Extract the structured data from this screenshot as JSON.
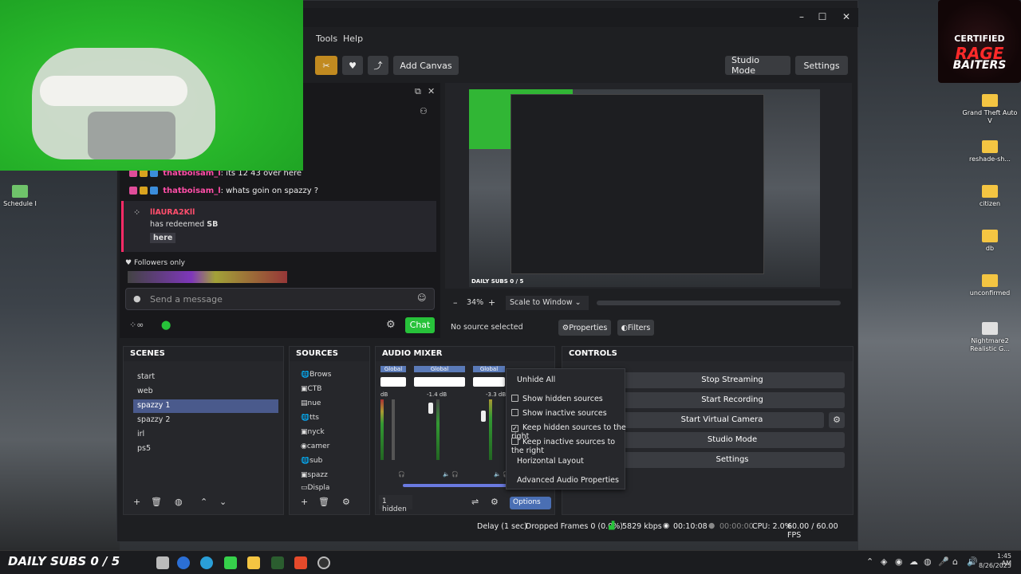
{
  "desktop": {
    "icons": [
      {
        "label": "Schedule I"
      },
      {
        "label": "Grand Theft Auto V"
      },
      {
        "label": "reshade-sh..."
      },
      {
        "label": "citizen"
      },
      {
        "label": "db"
      },
      {
        "label": "unconfirmed"
      },
      {
        "label": "Nightmare2 Realistic G..."
      }
    ]
  },
  "logo": {
    "line1": "CERTIFIED",
    "line2": "RAGE",
    "line3": "BAITERS"
  },
  "menu": {
    "tools": "Tools",
    "help": "Help"
  },
  "toolbar": {
    "add_canvas": "Add Canvas",
    "studio_mode": "Studio Mode",
    "settings": "Settings"
  },
  "chat": {
    "messages": [
      {
        "name": "thatboisam_l",
        "text": ": its 12 43 over here"
      },
      {
        "name": "thatboisam_l",
        "text": ": whats goin on spazzy ?"
      }
    ],
    "redeem": {
      "user": "llAURA2Kll",
      "text": "has redeemed",
      "reward": "SB",
      "message": "here"
    },
    "followers_only": "Followers only",
    "placeholder": "Send a message",
    "chat_button": "Chat"
  },
  "preview": {
    "zoom": "34%",
    "scale_mode": "Scale to Window",
    "no_source": "No source selected",
    "properties": "Properties",
    "filters": "Filters",
    "overlay_text": "DAILY SUBS 0 / 5"
  },
  "scenes": {
    "title": "SCENES",
    "items": [
      "start",
      "web",
      "spazzy 1",
      "spazzy 2",
      "irl",
      "ps5"
    ],
    "selected": "spazzy 1"
  },
  "sources": {
    "title": "SOURCES",
    "items": [
      "Brows",
      "CTB",
      "nue",
      "tts",
      "nyck",
      "camer",
      "sub",
      "spazz",
      "Displa"
    ]
  },
  "audio_mixer": {
    "title": "AUDIO MIXER",
    "channels": [
      {
        "label": "Global",
        "db": "dB"
      },
      {
        "label": "Global",
        "db": "-1.4 dB"
      },
      {
        "label": "Global",
        "db": "-3.3 dB"
      }
    ],
    "scale": [
      "0",
      "-6",
      "-12",
      "-18",
      "-24",
      "-30",
      "-36",
      "-42",
      "-48",
      "-54",
      "-60"
    ],
    "hidden": "1 hidden",
    "options": "Options"
  },
  "context_menu": {
    "unhide_all": "Unhide All",
    "show_hidden": "Show hidden sources",
    "show_inactive": "Show inactive sources",
    "keep_hidden_right": "Keep hidden sources to the right",
    "keep_inactive_right": "Keep inactive sources to the right",
    "horizontal_layout": "Horizontal Layout",
    "advanced_audio": "Advanced Audio Properties"
  },
  "controls": {
    "title": "CONTROLS",
    "stop_streaming": "Stop Streaming",
    "start_recording": "Start Recording",
    "start_virtual_camera": "Start Virtual Camera",
    "studio_mode": "Studio Mode",
    "settings": "Settings"
  },
  "statusbar": {
    "delay": "Delay (1 sec)",
    "dropped": "Dropped Frames 0 (0.0%)",
    "bitrate": "5829 kbps",
    "stream_time": "00:10:08",
    "rec_time": "00:00:00",
    "cpu": "CPU: 2.0%",
    "fps": "60.00 / 60.00 FPS"
  },
  "taskbar": {
    "overlay": "DAILY SUBS 0 / 5",
    "time": "1:45 AM",
    "date": "8/26/2025"
  },
  "colors": {
    "accent": "#4a5a8c",
    "chat_green": "#27c23a",
    "stream_green": "#31b635"
  }
}
